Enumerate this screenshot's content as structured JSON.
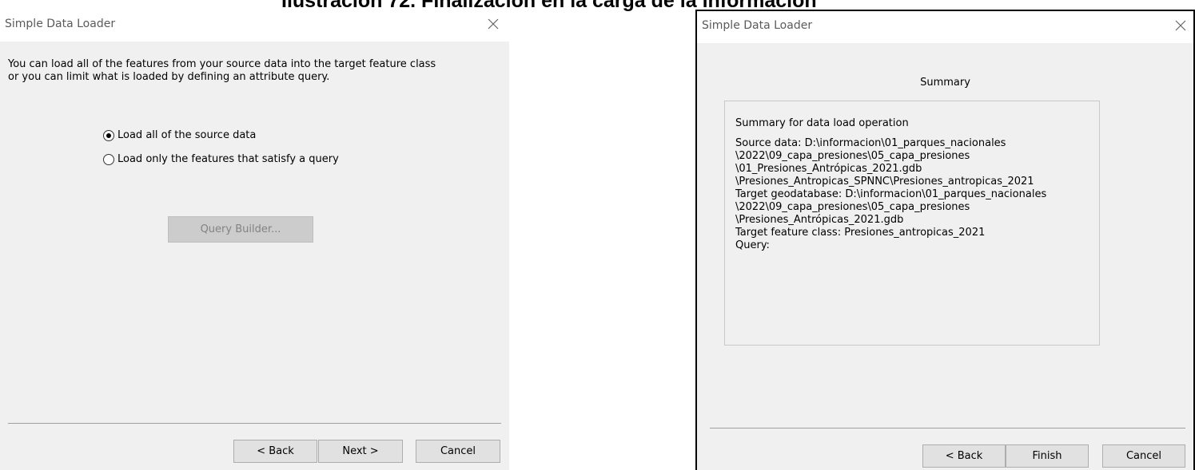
{
  "caption": "Ilustración 72. Finalización en la carga de la información",
  "dialog_left": {
    "title": "Simple Data Loader",
    "intro": "You can load all of the features from your source data into the target feature class or you can limit what is loaded by defining an attribute query.",
    "radio_all_label": "Load all of the source data",
    "radio_query_label": "Load only the features that satisfy a query",
    "selected_option": "Load all of the source data",
    "query_builder_label": "Query Builder...",
    "back_label": "< Back",
    "next_label": "Next >",
    "cancel_label": "Cancel"
  },
  "dialog_right": {
    "title": "Simple Data Loader",
    "heading": "Summary",
    "summary_lines": [
      "Summary for data load operation",
      "Source data: D:\\informacion\\01_parques_nacionales",
      "\\2022\\09_capa_presiones\\05_capa_presiones",
      "\\01_Presiones_Antrópicas_2021.gdb",
      "\\Presiones_Antropicas_SPNNC\\Presiones_antropicas_2021",
      "Target geodatabase: D:\\informacion\\01_parques_nacionales",
      "\\2022\\09_capa_presiones\\05_capa_presiones",
      "\\Presiones_Antrópicas_2021.gdb",
      "Target feature class: Presiones_antropicas_2021",
      "Query:"
    ],
    "back_label": "< Back",
    "finish_label": "Finish",
    "cancel_label": "Cancel"
  },
  "icons": {
    "close": "close-icon",
    "radio_on": "radio-selected-icon",
    "radio_off": "radio-unselected-icon"
  }
}
